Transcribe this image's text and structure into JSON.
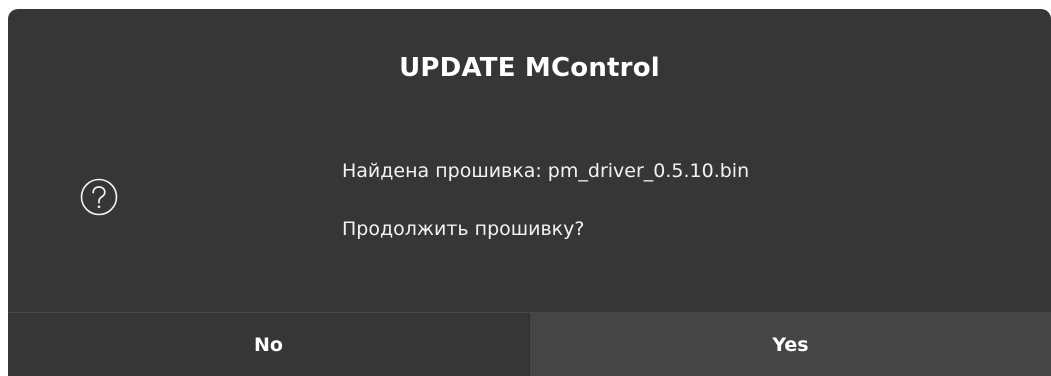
{
  "dialog": {
    "title": "UPDATE MControl",
    "icon": "question-circle-icon",
    "message_line1": "Найдена прошивка: pm_driver_0.5.10.bin",
    "message_line2": "Продолжить прошивку?"
  },
  "buttons": {
    "no_label": "No",
    "yes_label": "Yes"
  },
  "colors": {
    "dialog_bg": "#363636",
    "default_button_bg": "#454545",
    "text": "#ffffff"
  }
}
